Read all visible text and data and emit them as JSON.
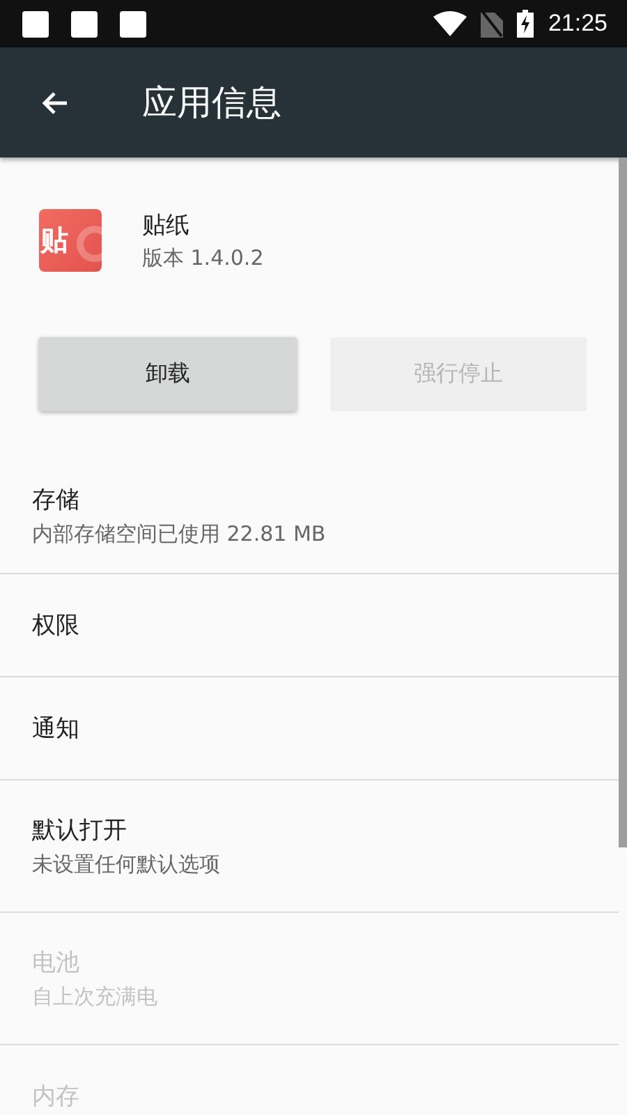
{
  "status_bar": {
    "time": "21:25"
  },
  "toolbar": {
    "title": "应用信息"
  },
  "app": {
    "name": "贴纸",
    "version": "版本 1.4.0.2",
    "icon_text": "贴"
  },
  "buttons": [
    {
      "label": "卸载",
      "disabled": false
    },
    {
      "label": "强行停止",
      "disabled": true
    }
  ],
  "settings": [
    {
      "title": "存储",
      "subtitle": "内部存储空间已使用 22.81 MB",
      "disabled": false
    },
    {
      "title": "权限",
      "disabled": false
    },
    {
      "title": "通知",
      "disabled": false
    },
    {
      "title": "默认打开",
      "subtitle": "未设置任何默认选项",
      "disabled": false
    },
    {
      "title": "电池",
      "subtitle": "自上次充满电",
      "disabled": true
    },
    {
      "title": "内存",
      "disabled": true
    }
  ]
}
